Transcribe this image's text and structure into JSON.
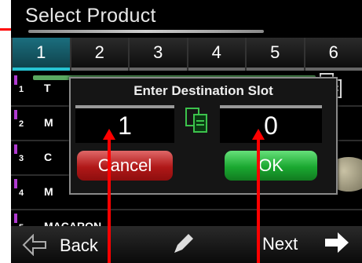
{
  "header": {
    "title": "Select Product"
  },
  "tabs": [
    {
      "label": "1",
      "active": true
    },
    {
      "label": "2"
    },
    {
      "label": "3"
    },
    {
      "label": "4"
    },
    {
      "label": "5"
    },
    {
      "label": "6"
    }
  ],
  "rows": [
    {
      "num": "1",
      "name": "T"
    },
    {
      "num": "2",
      "name": "M"
    },
    {
      "num": "3",
      "name": "C"
    },
    {
      "num": "4",
      "name": "M"
    },
    {
      "num": "5",
      "name": "MACARON"
    }
  ],
  "dialog": {
    "title": "Enter Destination Slot",
    "left_value": "1",
    "right_value": "0",
    "cancel_label": "Cancel",
    "ok_label": "OK"
  },
  "footer": {
    "back_label": "Back",
    "next_label": "Next"
  },
  "colors": {
    "active_tab": "#27c3d2",
    "cancel": "#b01818",
    "ok": "#1aa830",
    "annotation": "#ff0000"
  },
  "icons": [
    "back-arrow-icon",
    "pencil-icon",
    "next-arrow-icon",
    "copy-icon"
  ]
}
